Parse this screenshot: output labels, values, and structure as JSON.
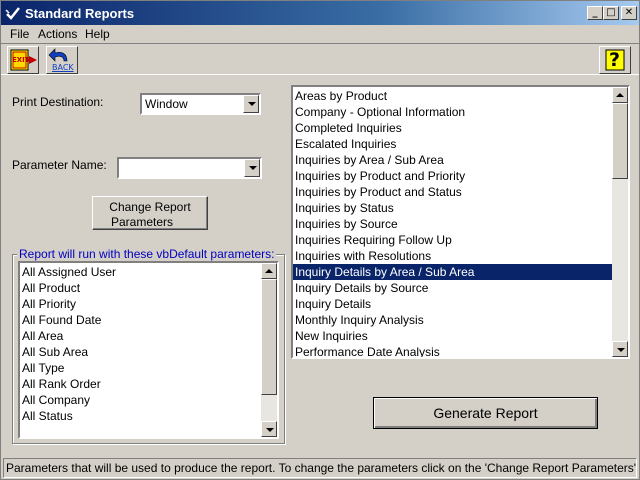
{
  "window": {
    "title": "Standard Reports",
    "minimize": "_",
    "maximize": "□",
    "close": "✕"
  },
  "menu": {
    "file": "File",
    "actions": "Actions",
    "help": "Help"
  },
  "toolbar": {
    "exit_label": "EXIT",
    "back_label": "BACK",
    "help_label": "?"
  },
  "form": {
    "print_destination_label": "Print Destination:",
    "print_destination_value": "Window",
    "parameter_name_label": "Parameter Name:",
    "parameter_name_value": "",
    "change_params_line1": "Change Report",
    "change_params_line2": "Parameters",
    "params_group_title": "Report will run with these vbDefault parameters:",
    "generate_button": "Generate Report"
  },
  "parameters": [
    "All Assigned User",
    "All Product",
    "All Priority",
    "All Found Date",
    "All Area",
    "All Sub Area",
    "All Type",
    "All Rank Order",
    "All Company",
    "All Status"
  ],
  "reports": [
    "Areas by Product",
    "Company - Optional Information",
    "Completed Inquiries",
    "Escalated Inquiries",
    "Inquiries by Area / Sub Area",
    "Inquiries by Product and Priority",
    "Inquiries by Product and Status",
    "Inquiries by Status",
    "Inquiries by Source",
    "Inquiries Requiring Follow Up",
    "Inquiries with Resolutions",
    "Inquiry Details by Area / Sub Area",
    "Inquiry Details by Source",
    "Inquiry Details",
    "Monthly Inquiry Analysis",
    "New Inquiries",
    "Performance Date Analysis"
  ],
  "selected_report": "Inquiry Details by Area / Sub Area",
  "status_text": "Parameters that will be used to produce the report.  To change the parameters click on the 'Change Report Parameters' butto",
  "colors": {
    "title_bar": "#0a246a",
    "selection": "#0a246a",
    "group_title": "#0000c0",
    "face": "#d4d0c8"
  }
}
